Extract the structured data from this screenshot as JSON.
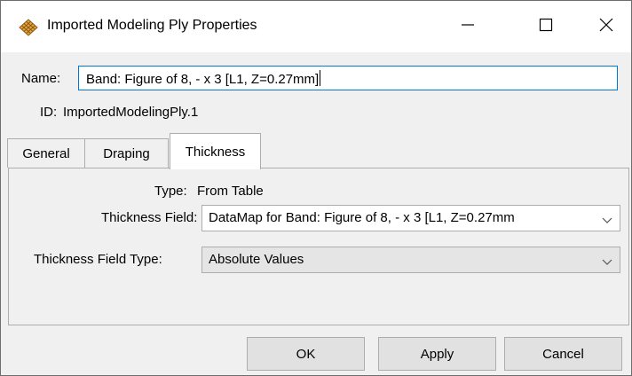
{
  "window": {
    "title": "Imported Modeling Ply Properties",
    "icon": "ply-grid-icon",
    "controls": [
      "minimize-icon",
      "maximize-icon",
      "close-icon"
    ]
  },
  "name": {
    "label": "Name:",
    "value": "Band: Figure of 8, - x 3 [L1, Z=0.27mm]"
  },
  "id": {
    "label": "ID:",
    "value": "ImportedModelingPly.1"
  },
  "tabs": [
    {
      "label": "General",
      "active": false
    },
    {
      "label": "Draping",
      "active": false
    },
    {
      "label": "Thickness",
      "active": true
    }
  ],
  "thickness": {
    "type_label": "Type:",
    "type_value": "From Table",
    "field_label": "Thickness Field:",
    "field_value": "DataMap for Band: Figure of 8, - x 3 [L1, Z=0.27mm",
    "field_type_label": "Thickness Field Type:",
    "field_type_value": "Absolute Values"
  },
  "buttons": {
    "ok": "OK",
    "apply": "Apply",
    "cancel": "Cancel"
  },
  "colors": {
    "focus_border": "#0078d7",
    "window_bg": "#f0f0f0",
    "button_bg": "#e1e1e1"
  }
}
